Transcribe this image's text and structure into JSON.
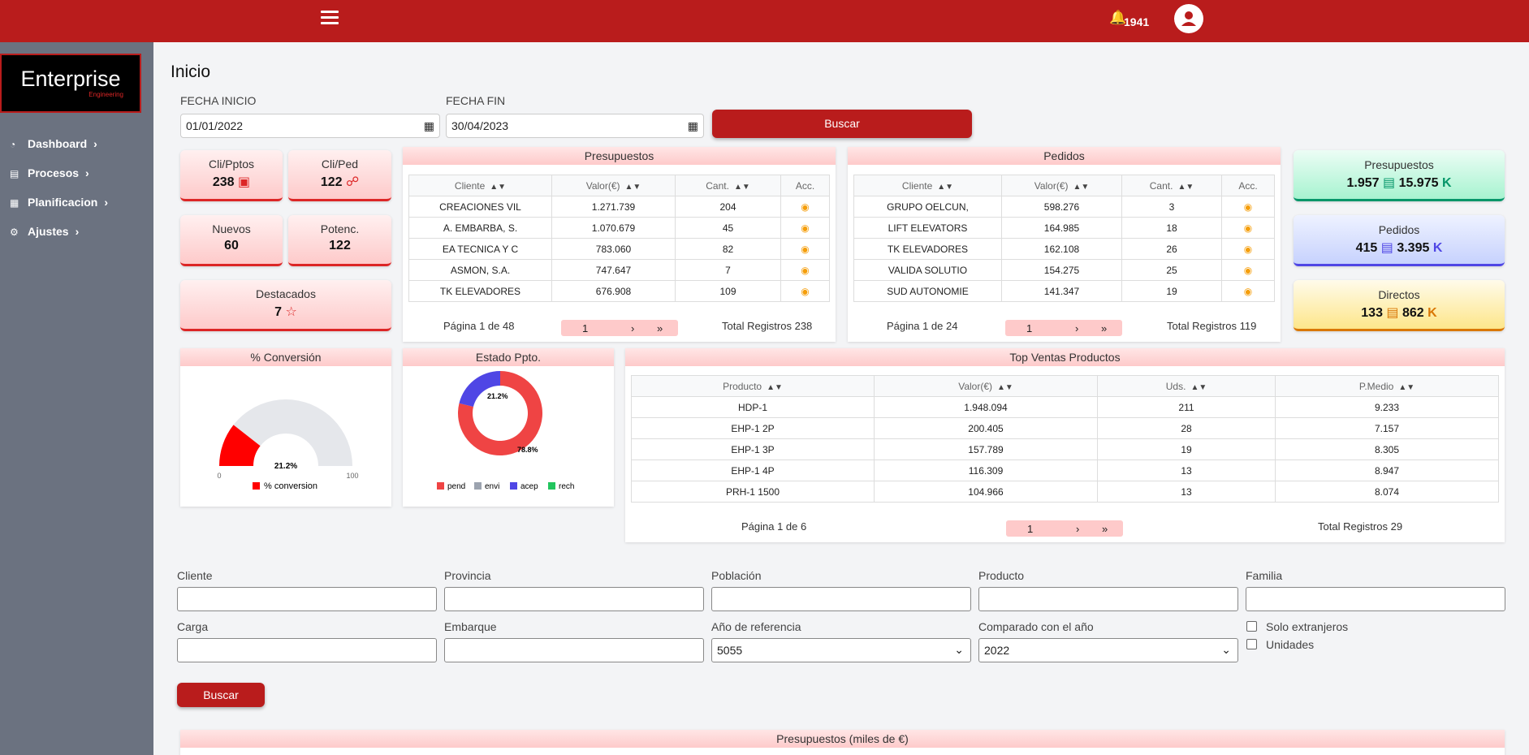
{
  "header": {
    "notif_count": "1941"
  },
  "logo": {
    "title": "Enterprise",
    "subtitle": "Engineering"
  },
  "sidebar": {
    "items": [
      {
        "label": "Dashboard"
      },
      {
        "label": "Procesos"
      },
      {
        "label": "Planificacion"
      },
      {
        "label": "Ajustes"
      }
    ]
  },
  "page": {
    "title": "Inicio"
  },
  "filters": {
    "start_label": "FECHA INICIO",
    "start_value": "01/01/2022",
    "end_label": "FECHA FIN",
    "end_value": "30/04/2023",
    "search": "Buscar"
  },
  "kpis": [
    {
      "label": "Cli/Pptos",
      "value": "238"
    },
    {
      "label": "Cli/Ped",
      "value": "122"
    },
    {
      "label": "Nuevos",
      "value": "60"
    },
    {
      "label": "Potenc.",
      "value": "122"
    },
    {
      "label": "Destacados",
      "value": "7"
    }
  ],
  "presupuestos": {
    "title": "Presupuestos",
    "cols": [
      "Cliente",
      "Valor(€)",
      "Cant.",
      "Acc."
    ],
    "rows": [
      [
        "CREACIONES VIL",
        "1.271.739",
        "204"
      ],
      [
        "A. EMBARBA, S.",
        "1.070.679",
        "45"
      ],
      [
        "EA TECNICA Y C",
        "783.060",
        "82"
      ],
      [
        "ASMON, S.A.",
        "747.647",
        "7"
      ],
      [
        "TK ELEVADORES",
        "676.908",
        "109"
      ]
    ],
    "page_info": "Página 1 de 48",
    "page": "1",
    "total": "Total Registros 238"
  },
  "pedidos": {
    "title": "Pedidos",
    "cols": [
      "Cliente",
      "Valor(€)",
      "Cant.",
      "Acc."
    ],
    "rows": [
      [
        "GRUPO OELCUN,",
        "598.276",
        "3"
      ],
      [
        "LIFT ELEVATORS",
        "164.985",
        "18"
      ],
      [
        "TK ELEVADORES",
        "162.108",
        "26"
      ],
      [
        "VALIDA SOLUTIO",
        "154.275",
        "25"
      ],
      [
        "SUD AUTONOMIE",
        "141.347",
        "19"
      ]
    ],
    "page_info": "Página 1 de 24",
    "page": "1",
    "total": "Total Registros 119"
  },
  "summary": [
    {
      "label": "Presupuestos",
      "count": "1.957",
      "amount": "15.975",
      "unit": "K",
      "color": "#059669"
    },
    {
      "label": "Pedidos",
      "count": "415",
      "amount": "3.395",
      "unit": "K",
      "color": "#4f46e5"
    },
    {
      "label": "Directos",
      "count": "133",
      "amount": "862",
      "unit": "K",
      "color": "#d97706"
    }
  ],
  "conversion": {
    "title": "% Conversión",
    "value_label": "21.2%",
    "min": "0",
    "max": "100",
    "legend": "% conversion",
    "value": 21.2
  },
  "estado": {
    "title": "Estado Ppto.",
    "labels": [
      "pend",
      "envi",
      "acep",
      "rech"
    ],
    "colors": [
      "#ef4444",
      "#9ca3af",
      "#4f46e5",
      "#22c55e"
    ],
    "values": [
      78.8,
      0,
      21.2,
      0
    ],
    "pend_label": "78.8%",
    "acep_label": "21.2%"
  },
  "top": {
    "title": "Top Ventas Productos",
    "cols": [
      "Producto",
      "Valor(€)",
      "Uds.",
      "P.Medio"
    ],
    "rows": [
      [
        "HDP-1",
        "1.948.094",
        "211",
        "9.233"
      ],
      [
        "EHP-1 2P",
        "200.405",
        "28",
        "7.157"
      ],
      [
        "EHP-1 3P",
        "157.789",
        "19",
        "8.305"
      ],
      [
        "EHP-1 4P",
        "116.309",
        "13",
        "8.947"
      ],
      [
        "PRH-1 1500",
        "104.966",
        "13",
        "8.074"
      ]
    ],
    "page_info": "Página 1 de 6",
    "page": "1",
    "total": "Total Registros 29"
  },
  "form": {
    "cliente": "Cliente",
    "provincia": "Provincia",
    "poblacion": "Población",
    "producto": "Producto",
    "familia": "Familia",
    "carga": "Carga",
    "embarque": "Embarque",
    "anio_ref": "Año de referencia",
    "anio_ref_value": "5055",
    "comparado": "Comparado con el año",
    "comparado_value": "2022",
    "solo_ext": "Solo extranjeros",
    "unidades": "Unidades",
    "search": "Buscar"
  },
  "bottom": {
    "title": "Presupuestos (miles de €)"
  }
}
